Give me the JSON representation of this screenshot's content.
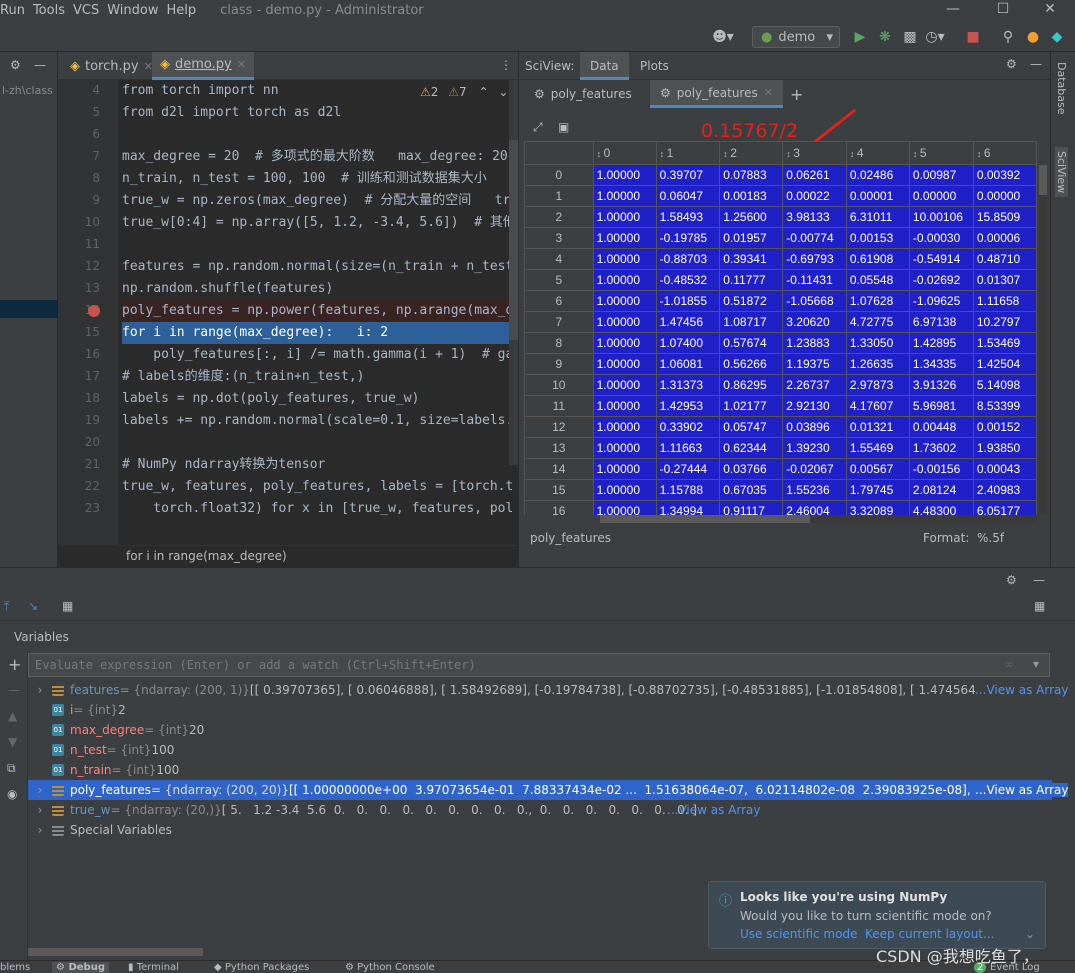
{
  "menu": [
    "Run",
    "Tools",
    "VCS",
    "Window",
    "Help"
  ],
  "window_title": "class - demo.py - Administrator",
  "toolbar": {
    "run_config": "demo"
  },
  "project_path_fragment": "l-zh\\class",
  "editor": {
    "tabs": [
      {
        "label": "torch.py",
        "active": false
      },
      {
        "label": "demo.py",
        "active": true
      }
    ],
    "warnings": {
      "errors": "2",
      "warnings": "7"
    },
    "lines": [
      {
        "n": "4",
        "text": "from torch import nn"
      },
      {
        "n": "5",
        "text": "from d2l import torch as d2l"
      },
      {
        "n": "6",
        "text": ""
      },
      {
        "n": "7",
        "text": "max_degree = 20  # 多项式的最大阶数   max_degree: 20"
      },
      {
        "n": "8",
        "text": "n_train, n_test = 100, 100  # 训练和测试数据集大小   n_"
      },
      {
        "n": "9",
        "text": "true_w = np.zeros(max_degree)  # 分配大量的空间   true"
      },
      {
        "n": "10",
        "text": "true_w[0:4] = np.array([5, 1.2, -3.4, 5.6])  # 其他"
      },
      {
        "n": "11",
        "text": ""
      },
      {
        "n": "12",
        "text": "features = np.random.normal(size=(n_train + n_test"
      },
      {
        "n": "13",
        "text": "np.random.shuffle(features)"
      },
      {
        "n": "14",
        "text": "poly_features = np.power(features, np.arange(max_d"
      },
      {
        "n": "15",
        "text": "for i in range(max_degree):   i: 2"
      },
      {
        "n": "16",
        "text": "    poly_features[:, i] /= math.gamma(i + 1)  # gam"
      },
      {
        "n": "17",
        "text": "# labels的维度:(n_train+n_test,)"
      },
      {
        "n": "18",
        "text": "labels = np.dot(poly_features, true_w)"
      },
      {
        "n": "19",
        "text": "labels += np.random.normal(scale=0.1, size=labels."
      },
      {
        "n": "20",
        "text": ""
      },
      {
        "n": "21",
        "text": "# NumPy ndarray转换为tensor"
      },
      {
        "n": "22",
        "text": "true_w, features, poly_features, labels = [torch.t"
      },
      {
        "n": "23",
        "text": "    torch.float32) for x in [true_w, features, pol"
      }
    ],
    "breadcrumb": "for i in range(max_degree)"
  },
  "sciview": {
    "label": "SciView:",
    "tabs": [
      "Data",
      "Plots"
    ],
    "data_tabs": [
      "poly_features",
      "poly_features"
    ],
    "columns": [
      "0",
      "1",
      "2",
      "3",
      "4",
      "5",
      "6"
    ],
    "rows": [
      [
        "0",
        "1.00000",
        "0.39707",
        "0.07883",
        "0.06261",
        "0.02486",
        "0.00987",
        "0.00392"
      ],
      [
        "1",
        "1.00000",
        "0.06047",
        "0.00183",
        "0.00022",
        "0.00001",
        "0.00000",
        "0.00000"
      ],
      [
        "2",
        "1.00000",
        "1.58493",
        "1.25600",
        "3.98133",
        "6.31011",
        "10.00106",
        "15.8509"
      ],
      [
        "3",
        "1.00000",
        "-0.19785",
        "0.01957",
        "-0.00774",
        "0.00153",
        "-0.00030",
        "0.00006"
      ],
      [
        "4",
        "1.00000",
        "-0.88703",
        "0.39341",
        "-0.69793",
        "0.61908",
        "-0.54914",
        "0.48710"
      ],
      [
        "5",
        "1.00000",
        "-0.48532",
        "0.11777",
        "-0.11431",
        "0.05548",
        "-0.02692",
        "0.01307"
      ],
      [
        "6",
        "1.00000",
        "-1.01855",
        "0.51872",
        "-1.05668",
        "1.07628",
        "-1.09625",
        "1.11658"
      ],
      [
        "7",
        "1.00000",
        "1.47456",
        "1.08717",
        "3.20620",
        "4.72775",
        "6.97138",
        "10.2797"
      ],
      [
        "8",
        "1.00000",
        "1.07400",
        "0.57674",
        "1.23883",
        "1.33050",
        "1.42895",
        "1.53469"
      ],
      [
        "9",
        "1.00000",
        "1.06081",
        "0.56266",
        "1.19375",
        "1.26635",
        "1.34335",
        "1.42504"
      ],
      [
        "10",
        "1.00000",
        "1.31373",
        "0.86295",
        "2.26737",
        "2.97873",
        "3.91326",
        "5.14098"
      ],
      [
        "11",
        "1.00000",
        "1.42953",
        "1.02177",
        "2.92130",
        "4.17607",
        "5.96981",
        "8.53399"
      ],
      [
        "12",
        "1.00000",
        "0.33902",
        "0.05747",
        "0.03896",
        "0.01321",
        "0.00448",
        "0.00152"
      ],
      [
        "13",
        "1.00000",
        "1.11663",
        "0.62344",
        "1.39230",
        "1.55469",
        "1.73602",
        "1.93850"
      ],
      [
        "14",
        "1.00000",
        "-0.27444",
        "0.03766",
        "-0.02067",
        "0.00567",
        "-0.00156",
        "0.00043"
      ],
      [
        "15",
        "1.00000",
        "1.15788",
        "0.67035",
        "1.55236",
        "1.79745",
        "2.08124",
        "2.40983"
      ],
      [
        "16",
        "1.00000",
        "1.34994",
        "0.91117",
        "2.46004",
        "3.32089",
        "4.48300",
        "6.05177"
      ]
    ],
    "footer_name": "poly_features",
    "format_label": "Format:",
    "format_value": "%.5f",
    "annotation": "0.15767/2"
  },
  "right_strip": [
    "Database",
    "SciView"
  ],
  "debug": {
    "variables_label": "Variables",
    "eval_placeholder": "Evaluate expression (Enter) or add a watch (Ctrl+Shift+Enter)",
    "vars": [
      {
        "name": "features",
        "type": " = {ndarray: (200, 1)} ",
        "value": "[[ 0.39707365], [ 0.06046888], [ 1.58492689], [-0.19784738], [-0.88702735], [-0.48531885], [-1.01854808], [ 1.47456428], [ 1.07:",
        "link": "...View as Array",
        "expand": true,
        "icon": "arr"
      },
      {
        "name": "i",
        "type": " = {int} ",
        "value": "2",
        "link": "",
        "expand": false,
        "icon": "int"
      },
      {
        "name": "max_degree",
        "type": " = {int} ",
        "value": "20",
        "link": "",
        "expand": false,
        "icon": "int"
      },
      {
        "name": "n_test",
        "type": " = {int} ",
        "value": "100",
        "link": "",
        "expand": false,
        "icon": "int"
      },
      {
        "name": "n_train",
        "type": " = {int} ",
        "value": "100",
        "link": "",
        "expand": false,
        "icon": "int"
      },
      {
        "name": "poly_features",
        "type": " = {ndarray: (200, 20)} ",
        "value": "[[ 1.00000000e+00  3.97073654e-01  7.88337434e-02 ...  1.51638064e-07,  6.02114802e-08  2.39083925e-08], [ 1.0000",
        "link": "...View as Array",
        "expand": true,
        "icon": "arr"
      },
      {
        "name": "true_w",
        "type": " = {ndarray: (20,)} ",
        "value": "[ 5.   1.2 -3.4  5.6  0.   0.   0.   0.   0.   0.   0.   0.   0.,  0.   0.   0.   0.   0.   0.   0. ]",
        "link": "...View as Array",
        "expand": true,
        "icon": "arr"
      },
      {
        "name": "Special Variables",
        "type": "",
        "value": "",
        "link": "",
        "expand": true,
        "icon": "special"
      }
    ]
  },
  "notification": {
    "title": "Looks like you're using NumPy",
    "body": "Would you like to turn scientific mode on?",
    "action1": "Use scientific mode",
    "action2": "Keep current layout..."
  },
  "status": {
    "items": [
      "blems",
      "Debug",
      "Terminal",
      "Python Packages",
      "Python Console"
    ],
    "event_count": "2",
    "event_log": "Event Log"
  },
  "watermark": "CSDN @我想吃鱼了，"
}
